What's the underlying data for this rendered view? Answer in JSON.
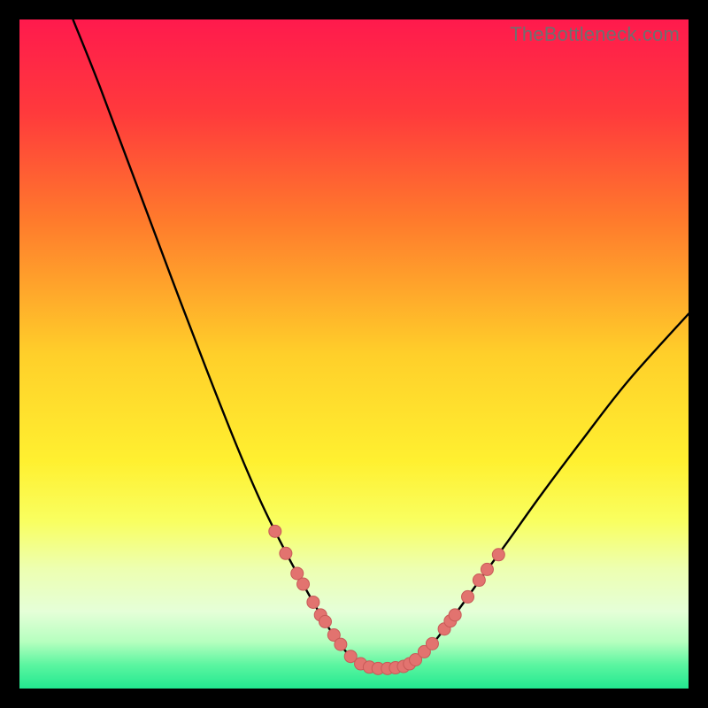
{
  "watermark": "TheBottleneck.com",
  "chart_data": {
    "type": "line",
    "title": "",
    "xlabel": "",
    "ylabel": "",
    "xlim": [
      0,
      100
    ],
    "ylim": [
      0,
      100
    ],
    "gradient_stops": [
      {
        "offset": 0.0,
        "color": "#ff1a4d"
      },
      {
        "offset": 0.14,
        "color": "#ff3a3c"
      },
      {
        "offset": 0.3,
        "color": "#ff7a2c"
      },
      {
        "offset": 0.5,
        "color": "#ffcf2a"
      },
      {
        "offset": 0.66,
        "color": "#fff030"
      },
      {
        "offset": 0.75,
        "color": "#f9ff60"
      },
      {
        "offset": 0.82,
        "color": "#edffb0"
      },
      {
        "offset": 0.885,
        "color": "#e5ffd8"
      },
      {
        "offset": 0.93,
        "color": "#b6ffbf"
      },
      {
        "offset": 0.965,
        "color": "#5af5a0"
      },
      {
        "offset": 1.0,
        "color": "#23e890"
      }
    ],
    "series": [
      {
        "name": "bottleneck-curve",
        "type": "line",
        "points": [
          {
            "x": 8.0,
            "y": 100.0
          },
          {
            "x": 12.0,
            "y": 90.0
          },
          {
            "x": 18.0,
            "y": 74.0
          },
          {
            "x": 24.0,
            "y": 58.0
          },
          {
            "x": 29.0,
            "y": 45.0
          },
          {
            "x": 33.0,
            "y": 35.0
          },
          {
            "x": 36.5,
            "y": 27.0
          },
          {
            "x": 40.0,
            "y": 20.0
          },
          {
            "x": 43.0,
            "y": 14.5
          },
          {
            "x": 45.5,
            "y": 10.2
          },
          {
            "x": 47.5,
            "y": 7.2
          },
          {
            "x": 49.0,
            "y": 5.3
          },
          {
            "x": 50.5,
            "y": 4.0
          },
          {
            "x": 52.0,
            "y": 3.3
          },
          {
            "x": 53.5,
            "y": 3.0
          },
          {
            "x": 55.0,
            "y": 3.0
          },
          {
            "x": 57.0,
            "y": 3.2
          },
          {
            "x": 58.5,
            "y": 3.8
          },
          {
            "x": 60.0,
            "y": 5.0
          },
          {
            "x": 62.0,
            "y": 7.0
          },
          {
            "x": 64.0,
            "y": 9.6
          },
          {
            "x": 66.0,
            "y": 12.3
          },
          {
            "x": 69.0,
            "y": 16.5
          },
          {
            "x": 73.0,
            "y": 22.0
          },
          {
            "x": 78.0,
            "y": 29.0
          },
          {
            "x": 84.0,
            "y": 37.0
          },
          {
            "x": 91.0,
            "y": 46.0
          },
          {
            "x": 100.0,
            "y": 56.0
          }
        ]
      },
      {
        "name": "markers-left",
        "type": "scatter",
        "points": [
          {
            "x": 38.2,
            "y": 23.5
          },
          {
            "x": 39.8,
            "y": 20.2
          },
          {
            "x": 41.5,
            "y": 17.2
          },
          {
            "x": 42.4,
            "y": 15.6
          },
          {
            "x": 43.9,
            "y": 12.9
          },
          {
            "x": 45.0,
            "y": 11.0
          },
          {
            "x": 45.7,
            "y": 10.0
          },
          {
            "x": 47.0,
            "y": 8.0
          },
          {
            "x": 48.0,
            "y": 6.6
          }
        ]
      },
      {
        "name": "markers-bottom",
        "type": "scatter",
        "points": [
          {
            "x": 49.5,
            "y": 4.8
          },
          {
            "x": 51.0,
            "y": 3.7
          },
          {
            "x": 52.3,
            "y": 3.2
          },
          {
            "x": 53.6,
            "y": 3.0
          },
          {
            "x": 55.0,
            "y": 3.0
          },
          {
            "x": 56.2,
            "y": 3.1
          },
          {
            "x": 57.4,
            "y": 3.3
          },
          {
            "x": 58.3,
            "y": 3.7
          },
          {
            "x": 59.2,
            "y": 4.3
          }
        ]
      },
      {
        "name": "markers-right",
        "type": "scatter",
        "points": [
          {
            "x": 60.5,
            "y": 5.5
          },
          {
            "x": 61.7,
            "y": 6.7
          },
          {
            "x": 63.5,
            "y": 8.9
          },
          {
            "x": 64.4,
            "y": 10.1
          },
          {
            "x": 65.1,
            "y": 11.0
          },
          {
            "x": 67.0,
            "y": 13.7
          },
          {
            "x": 68.7,
            "y": 16.2
          },
          {
            "x": 69.9,
            "y": 17.8
          },
          {
            "x": 71.6,
            "y": 20.0
          }
        ]
      }
    ],
    "marker_style": {
      "radius": 7,
      "fill": "#e2736f",
      "stroke": "#c85a58"
    },
    "line_style": {
      "stroke": "#000000",
      "width": 2.4
    }
  }
}
